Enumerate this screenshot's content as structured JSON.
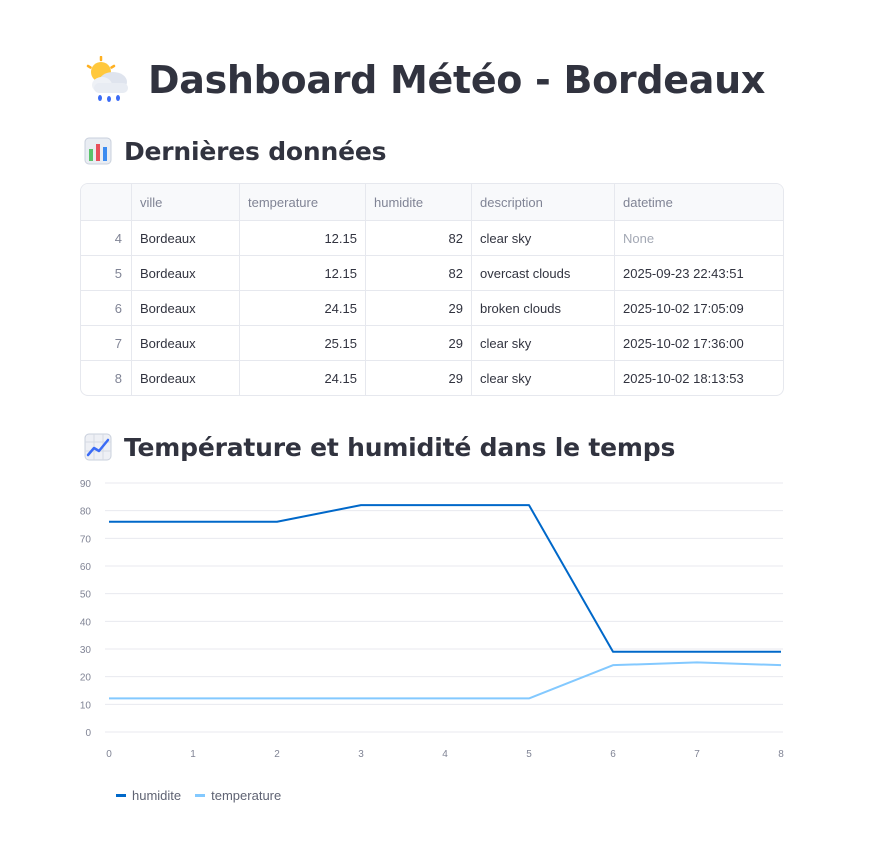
{
  "page": {
    "title": "Dashboard Météo - Bordeaux",
    "title_icon": "sun-behind-rain-cloud-icon"
  },
  "sections": {
    "latest": {
      "heading": "Dernières données",
      "icon": "bar-chart-icon"
    },
    "timeseries": {
      "heading": "Température et humidité dans le temps",
      "icon": "chart-increasing-icon"
    }
  },
  "table": {
    "columns": [
      "",
      "ville",
      "temperature",
      "humidite",
      "description",
      "datetime"
    ],
    "rows": [
      {
        "index": "4",
        "ville": "Bordeaux",
        "temperature": "12.15",
        "humidite": "82",
        "description": "clear sky",
        "datetime": "None"
      },
      {
        "index": "5",
        "ville": "Bordeaux",
        "temperature": "12.15",
        "humidite": "82",
        "description": "overcast clouds",
        "datetime": "2025-09-23 22:43:51"
      },
      {
        "index": "6",
        "ville": "Bordeaux",
        "temperature": "24.15",
        "humidite": "29",
        "description": "broken clouds",
        "datetime": "2025-10-02 17:05:09"
      },
      {
        "index": "7",
        "ville": "Bordeaux",
        "temperature": "25.15",
        "humidite": "29",
        "description": "clear sky",
        "datetime": "2025-10-02 17:36:00"
      },
      {
        "index": "8",
        "ville": "Bordeaux",
        "temperature": "24.15",
        "humidite": "29",
        "description": "clear sky",
        "datetime": "2025-10-02 18:13:53"
      }
    ]
  },
  "chart_data": {
    "type": "line",
    "x": [
      0,
      1,
      2,
      3,
      4,
      5,
      6,
      7,
      8
    ],
    "series": [
      {
        "name": "humidite",
        "color": "#0068c9",
        "values": [
          76,
          76,
          76,
          82,
          82,
          82,
          29,
          29,
          29
        ]
      },
      {
        "name": "temperature",
        "color": "#83c9ff",
        "values": [
          12.15,
          12.15,
          12.15,
          12.15,
          12.15,
          12.15,
          24.15,
          25.15,
          24.15
        ]
      }
    ],
    "yticks": [
      0,
      10,
      20,
      30,
      40,
      50,
      60,
      70,
      80,
      90
    ],
    "xticks": [
      0,
      1,
      2,
      3,
      4,
      5,
      6,
      7,
      8
    ],
    "ylim": [
      0,
      90
    ],
    "xlim": [
      0,
      8
    ],
    "grid": true,
    "legend": "bottom-left"
  }
}
